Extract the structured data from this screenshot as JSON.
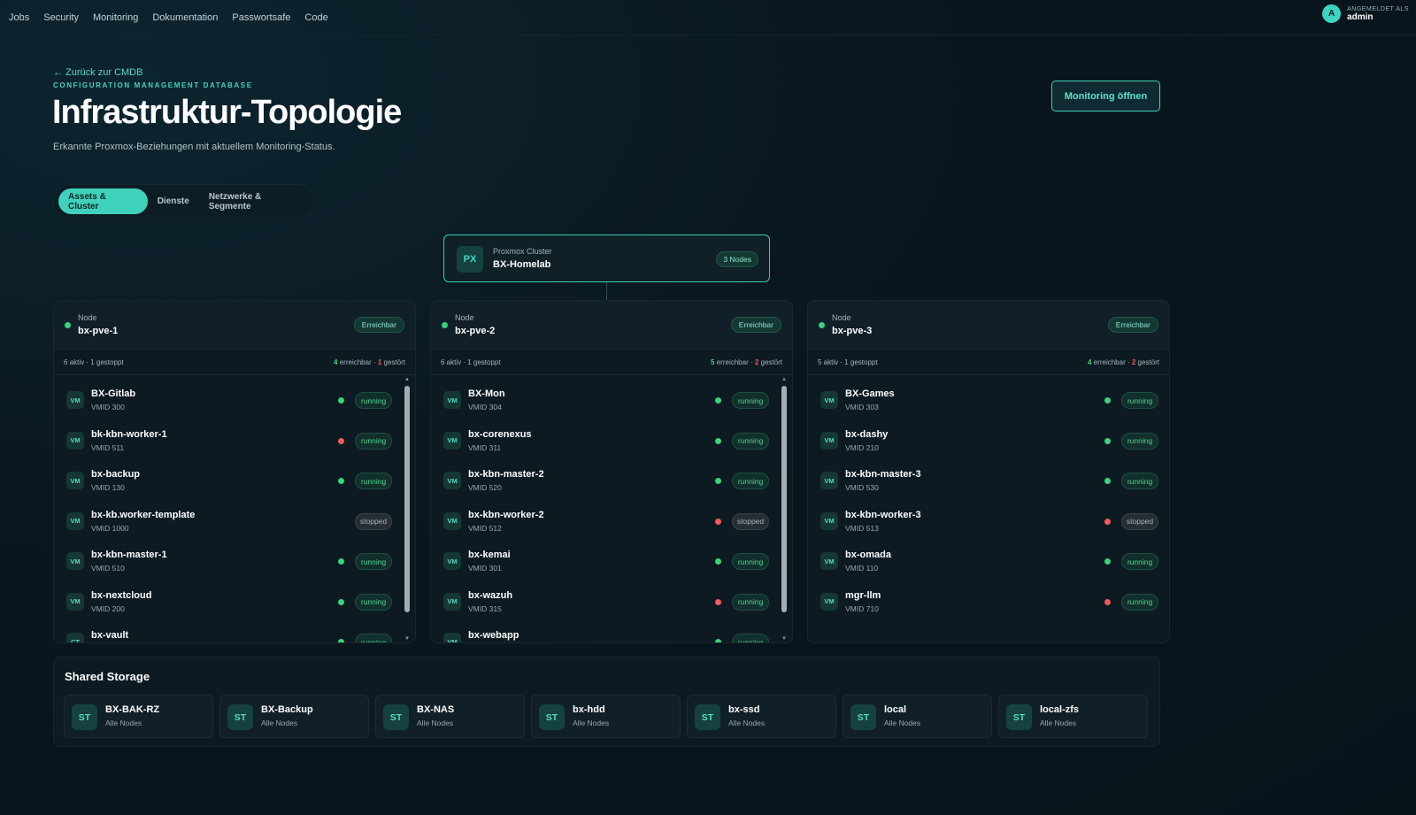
{
  "nav": {
    "links": [
      "Jobs",
      "Security",
      "Monitoring",
      "Dokumentation",
      "Passwortsafe",
      "Code"
    ],
    "user_label": "ANGEMELDET ALS",
    "user_name": "admin",
    "avatar_initial": "A"
  },
  "header": {
    "back_link": "← Zurück zur CMDB",
    "kicker": "CONFIGURATION MANAGEMENT DATABASE",
    "title": "Infrastruktur-Topologie",
    "subtitle": "Erkannte Proxmox-Beziehungen mit aktuellem Monitoring-Status.",
    "monitoring_button": "Monitoring öffnen"
  },
  "tabs": [
    {
      "label": "Assets & Cluster",
      "active": true
    },
    {
      "label": "Dienste",
      "active": false
    },
    {
      "label": "Netzwerke & Segmente",
      "active": false
    }
  ],
  "cluster": {
    "icon": "PX",
    "type_label": "Proxmox Cluster",
    "name": "BX-Homelab",
    "node_count": "3 Nodes"
  },
  "colors": {
    "accent": "#3fd1bc",
    "ok": "#39d37a",
    "error": "#f25a5a",
    "background": "#0a1720"
  },
  "nodes": [
    {
      "type_label": "Node",
      "name": "bx-pve-1",
      "status": "Erreichbar",
      "stats_left": "6 aktiv · 1 gestoppt",
      "reachable_count": "4",
      "reachable_label": " erreichbar · ",
      "error_count": "1",
      "error_label": " gestört",
      "scrollable": true,
      "vms": [
        {
          "icon": "VM",
          "name": "BX-Gitlab",
          "vmid": "VMID 300",
          "health": "ok",
          "state": "running"
        },
        {
          "icon": "VM",
          "name": "bk-kbn-worker-1",
          "vmid": "VMID 511",
          "health": "error",
          "state": "running"
        },
        {
          "icon": "VM",
          "name": "bx-backup",
          "vmid": "VMID 130",
          "health": "ok",
          "state": "running"
        },
        {
          "icon": "VM",
          "name": "bx-kb.worker-template",
          "vmid": "VMID 1000",
          "health": "none",
          "state": "stopped"
        },
        {
          "icon": "VM",
          "name": "bx-kbn-master-1",
          "vmid": "VMID 510",
          "health": "ok",
          "state": "running"
        },
        {
          "icon": "VM",
          "name": "bx-nextcloud",
          "vmid": "VMID 200",
          "health": "ok",
          "state": "running"
        },
        {
          "icon": "CT",
          "name": "bx-vault",
          "vmid": "",
          "health": "ok",
          "state": "running"
        }
      ]
    },
    {
      "type_label": "Node",
      "name": "bx-pve-2",
      "status": "Erreichbar",
      "stats_left": "6 aktiv · 1 gestoppt",
      "reachable_count": "5",
      "reachable_label": " erreichbar · ",
      "error_count": "2",
      "error_label": " gestört",
      "scrollable": true,
      "vms": [
        {
          "icon": "VM",
          "name": "BX-Mon",
          "vmid": "VMID 304",
          "health": "ok",
          "state": "running"
        },
        {
          "icon": "VM",
          "name": "bx-corenexus",
          "vmid": "VMID 311",
          "health": "ok",
          "state": "running"
        },
        {
          "icon": "VM",
          "name": "bx-kbn-master-2",
          "vmid": "VMID 520",
          "health": "ok",
          "state": "running"
        },
        {
          "icon": "VM",
          "name": "bx-kbn-worker-2",
          "vmid": "VMID 512",
          "health": "error",
          "state": "stopped"
        },
        {
          "icon": "VM",
          "name": "bx-kemai",
          "vmid": "VMID 301",
          "health": "ok",
          "state": "running"
        },
        {
          "icon": "VM",
          "name": "bx-wazuh",
          "vmid": "VMID 315",
          "health": "error",
          "state": "running"
        },
        {
          "icon": "VM",
          "name": "bx-webapp",
          "vmid": "",
          "health": "ok",
          "state": "running"
        }
      ]
    },
    {
      "type_label": "Node",
      "name": "bx-pve-3",
      "status": "Erreichbar",
      "stats_left": "5 aktiv · 1 gestoppt",
      "reachable_count": "4",
      "reachable_label": " erreichbar · ",
      "error_count": "2",
      "error_label": " gestört",
      "scrollable": false,
      "vms": [
        {
          "icon": "VM",
          "name": "BX-Games",
          "vmid": "VMID 303",
          "health": "ok",
          "state": "running"
        },
        {
          "icon": "VM",
          "name": "bx-dashy",
          "vmid": "VMID 210",
          "health": "ok",
          "state": "running"
        },
        {
          "icon": "VM",
          "name": "bx-kbn-master-3",
          "vmid": "VMID 530",
          "health": "ok",
          "state": "running"
        },
        {
          "icon": "VM",
          "name": "bx-kbn-worker-3",
          "vmid": "VMID 513",
          "health": "error",
          "state": "stopped"
        },
        {
          "icon": "VM",
          "name": "bx-omada",
          "vmid": "VMID 110",
          "health": "ok",
          "state": "running"
        },
        {
          "icon": "VM",
          "name": "mgr-llm",
          "vmid": "VMID 710",
          "health": "error",
          "state": "running"
        }
      ]
    }
  ],
  "storage": {
    "title": "Shared Storage",
    "items": [
      {
        "icon": "ST",
        "name": "BX-BAK-RZ",
        "desc": "Alle Nodes"
      },
      {
        "icon": "ST",
        "name": "BX-Backup",
        "desc": "Alle Nodes"
      },
      {
        "icon": "ST",
        "name": "BX-NAS",
        "desc": "Alle Nodes"
      },
      {
        "icon": "ST",
        "name": "bx-hdd",
        "desc": "Alle Nodes"
      },
      {
        "icon": "ST",
        "name": "bx-ssd",
        "desc": "Alle Nodes"
      },
      {
        "icon": "ST",
        "name": "local",
        "desc": "Alle Nodes"
      },
      {
        "icon": "ST",
        "name": "local-zfs",
        "desc": "Alle Nodes"
      }
    ]
  }
}
